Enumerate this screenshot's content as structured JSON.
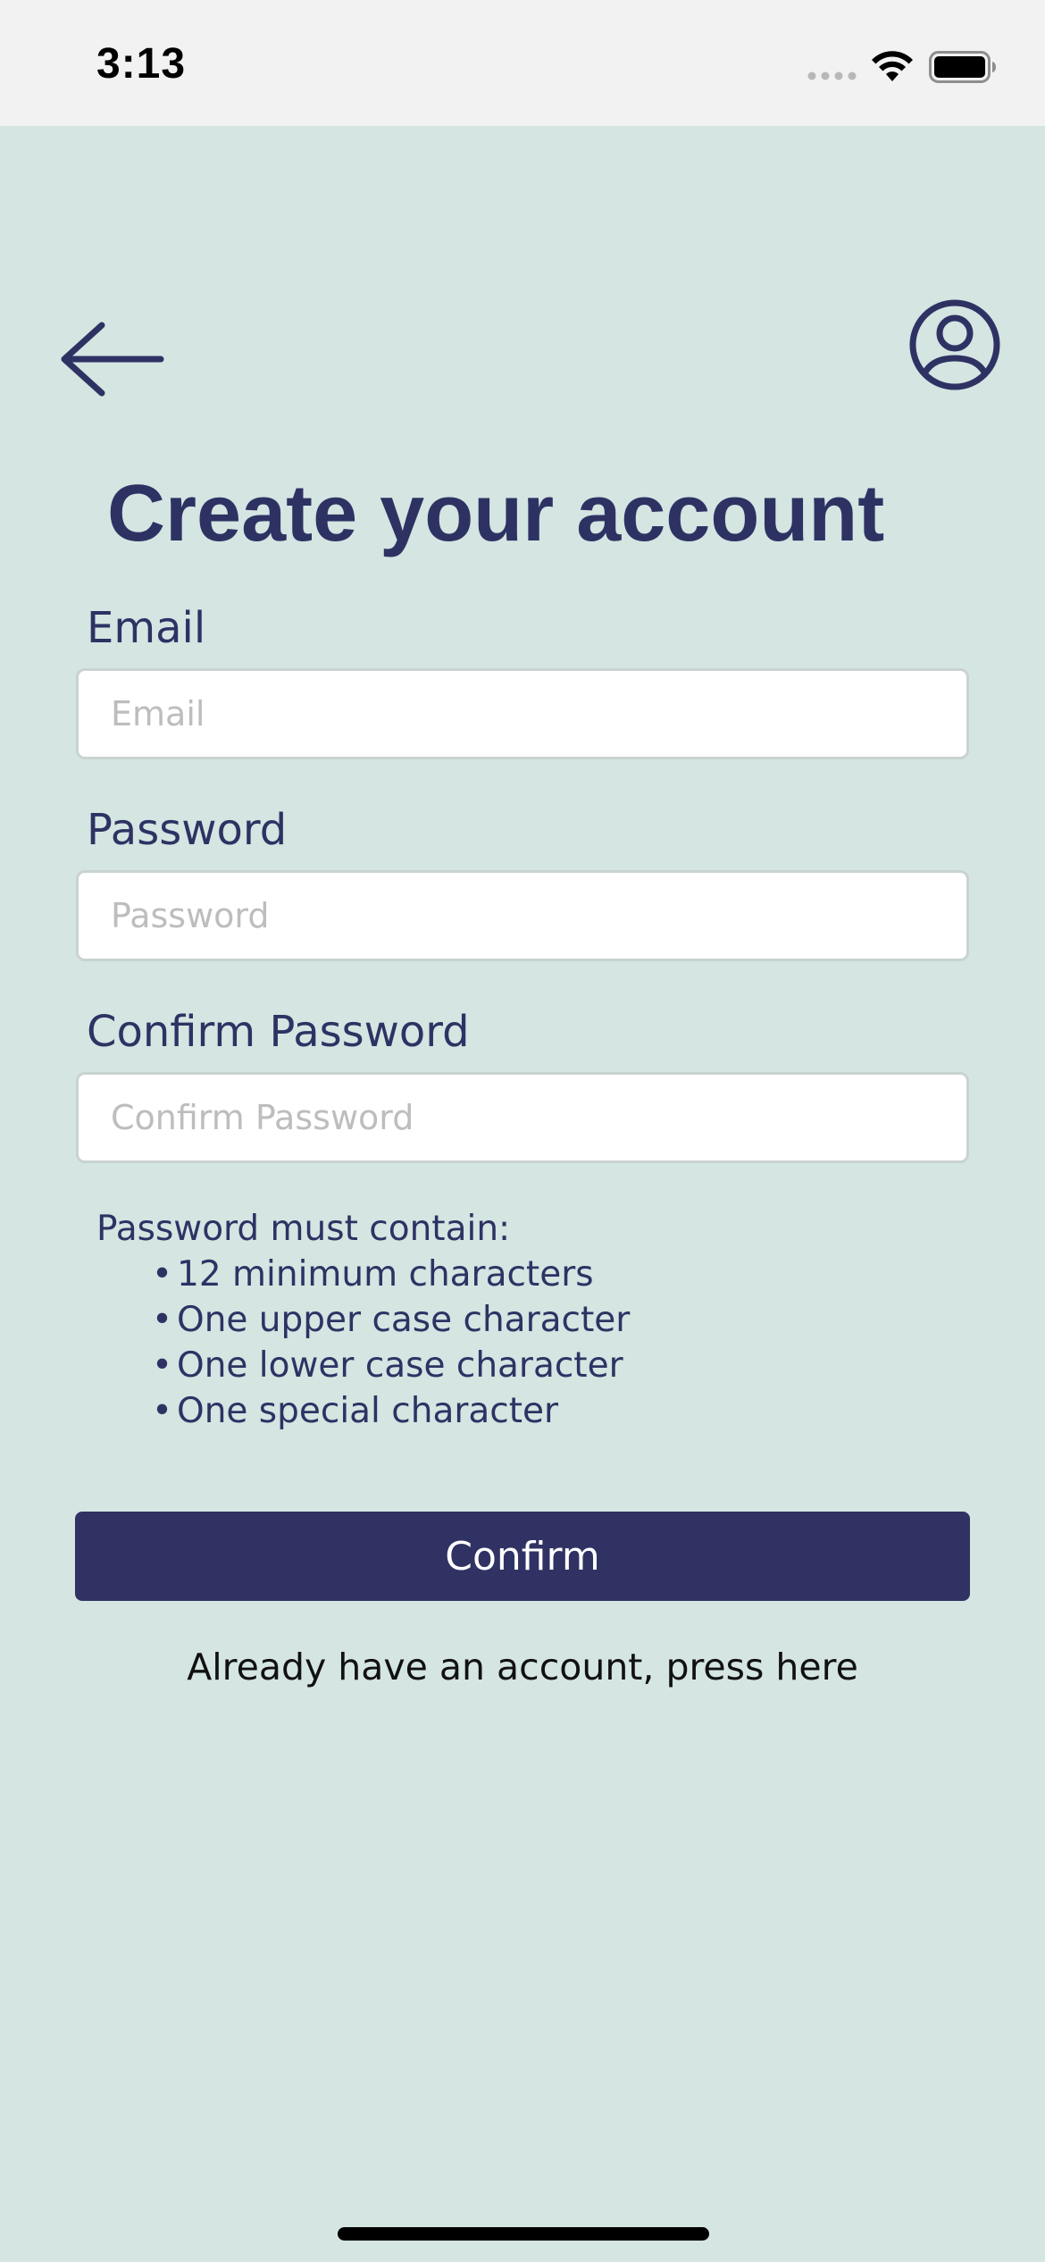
{
  "status_bar": {
    "time": "3:13"
  },
  "header": {
    "back_icon": "arrow-left-icon",
    "profile_icon": "user-circle-icon"
  },
  "page": {
    "title": "Create your account"
  },
  "form": {
    "email": {
      "label": "Email",
      "placeholder": "Email",
      "value": ""
    },
    "password": {
      "label": "Password",
      "placeholder": "Password",
      "value": ""
    },
    "confirm_password": {
      "label": "Confirm Password",
      "placeholder": "Confirm Password",
      "value": ""
    }
  },
  "requirements": {
    "heading": "Password must contain:",
    "bullet": "•",
    "items": [
      "12 minimum characters",
      "One upper case character",
      "One lower case character",
      "One special character"
    ]
  },
  "actions": {
    "confirm_label": "Confirm",
    "login_link": "Already have an account, press here"
  },
  "colors": {
    "background": "#d4e5e2",
    "accent": "#2f3263",
    "status_bar": "#f2f2f2"
  }
}
